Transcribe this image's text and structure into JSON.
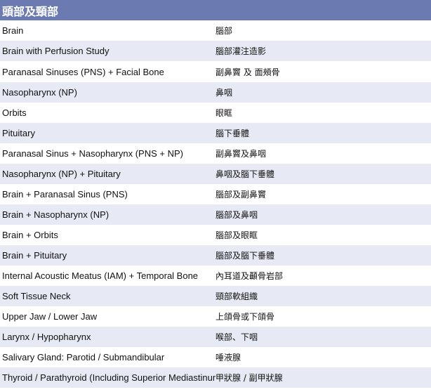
{
  "table": {
    "title": "頭部及頸部",
    "rows": [
      {
        "en": "Brain",
        "zh": "腦部"
      },
      {
        "en": "Brain with Perfusion Study",
        "zh": "腦部灌注造影"
      },
      {
        "en": "Paranasal Sinuses (PNS) + Facial Bone",
        "zh": "副鼻竇 及 面頰骨"
      },
      {
        "en": "Nasopharynx (NP)",
        "zh": "鼻咽"
      },
      {
        "en": "Orbits",
        "zh": "眼眶"
      },
      {
        "en": "Pituitary",
        "zh": "腦下垂體"
      },
      {
        "en": "Paranasal Sinus + Nasopharynx (PNS + NP)",
        "zh": "副鼻竇及鼻咽"
      },
      {
        "en": "Nasopharynx (NP) + Pituitary",
        "zh": "鼻咽及腦下垂體"
      },
      {
        "en": "Brain + Paranasal Sinus (PNS)",
        "zh": "腦部及副鼻竇"
      },
      {
        "en": "Brain + Nasopharynx (NP)",
        "zh": "腦部及鼻咽"
      },
      {
        "en": "Brain + Orbits",
        "zh": "腦部及眼眶"
      },
      {
        "en": "Brain + Pituitary",
        "zh": "腦部及腦下垂體"
      },
      {
        "en": "Internal Acoustic Meatus (IAM) + Temporal Bone",
        "zh": "內耳道及顳骨岩部"
      },
      {
        "en": "Soft Tissue Neck",
        "zh": "頸部軟組織"
      },
      {
        "en": "Upper Jaw / Lower Jaw",
        "zh": "上頜骨或下頜骨"
      },
      {
        "en": "Larynx / Hypopharynx",
        "zh": "喉部、下咽"
      },
      {
        "en": "Salivary Gland: Parotid / Submandibular",
        "zh": "唾液腺"
      },
      {
        "en": "Thyroid / Parathyroid (Including Superior Mediastinum)",
        "zh": "甲狀腺 / 副甲狀腺"
      }
    ]
  },
  "colors": {
    "header_bg": "#6b7bb1",
    "stripe_bg": "#e7eaf4"
  }
}
